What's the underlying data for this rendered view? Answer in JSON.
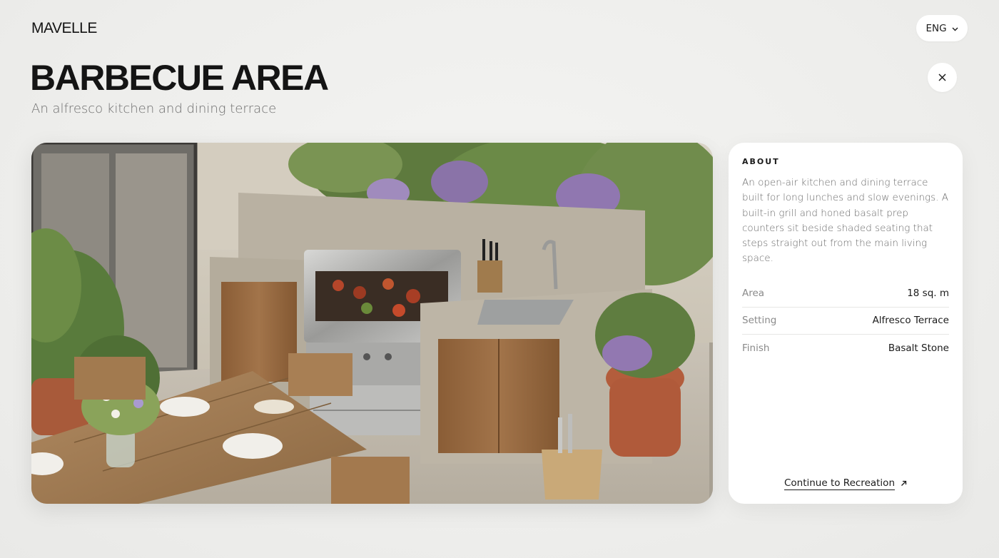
{
  "brand": {
    "logo": "MAVELLE"
  },
  "header": {
    "language": "ENG"
  },
  "page": {
    "title": "BARBECUE AREA",
    "subtitle": "An alfresco kitchen and dining terrace"
  },
  "icons": {
    "language_chevron": "chevron-down-icon",
    "close": "close-icon",
    "link_arrow": "arrow-up-right-icon"
  },
  "about": {
    "heading": "ABOUT",
    "text": "An open-air kitchen and dining terrace built for long lunches and slow evenings. A built-in grill and honed basalt prep counters sit beside shaded seating that steps straight out from the main living space."
  },
  "specs": [
    {
      "label": "Area",
      "value": "18 sq. m"
    },
    {
      "label": "Setting",
      "value": "Alfresco Terrace"
    },
    {
      "label": "Finish",
      "value": "Basalt Stone"
    }
  ],
  "cta": {
    "label": "Continue to Recreation"
  },
  "colors": {
    "background": "#eeeeec",
    "card": "#ffffff",
    "text": "#1b1b1b",
    "muted": "#6f6f6f"
  }
}
